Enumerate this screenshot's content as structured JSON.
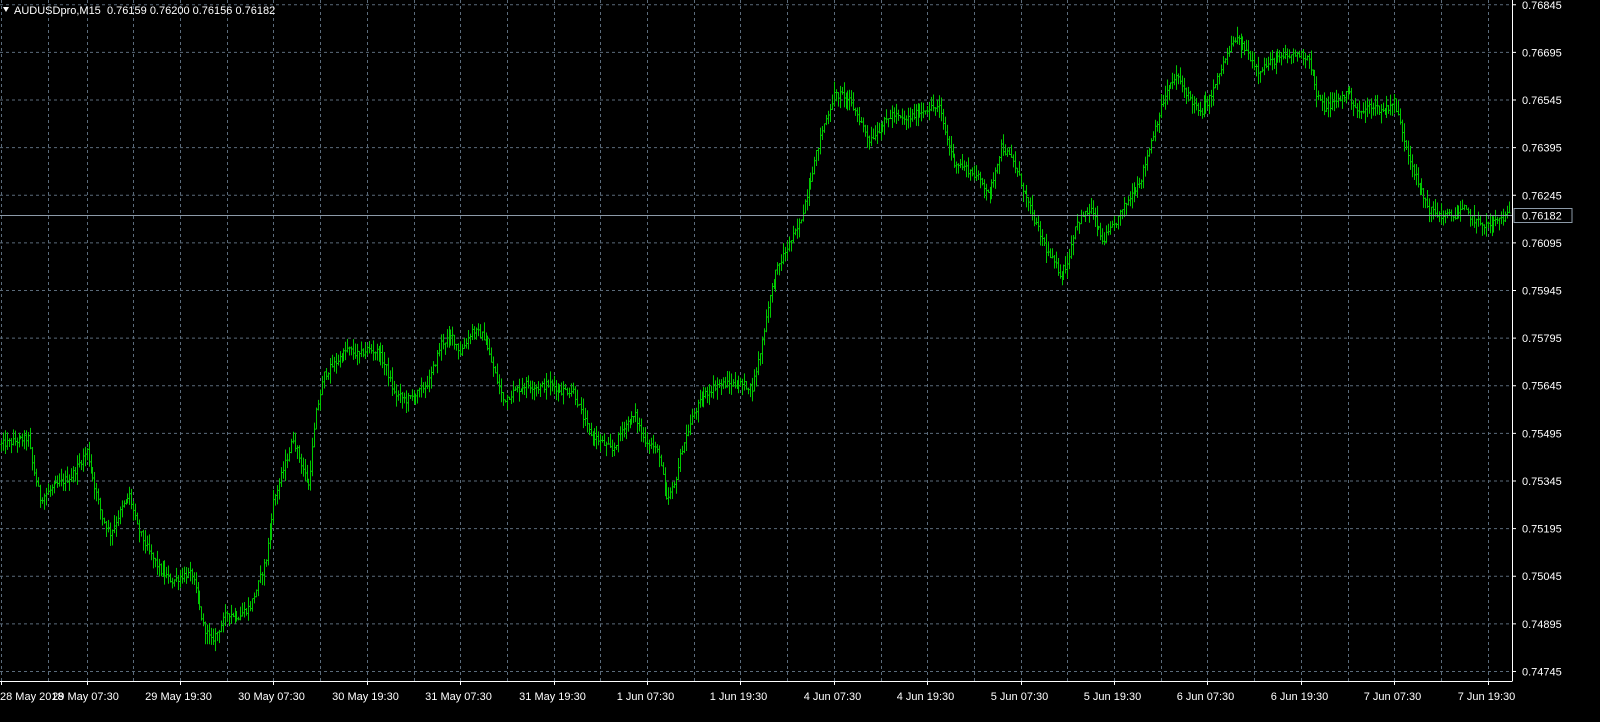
{
  "window": {
    "symbol_line": "AUDUSDpro,M15",
    "ohlc": "0.76159 0.76200 0.76156 0.76182",
    "menu_icon": "triangle-down-icon"
  },
  "colors": {
    "background": "#000000",
    "bars": "#00C800",
    "grid": "#5B6B7B",
    "axis_text": "#FFFFFF",
    "price_line": "#8C9AA8",
    "price_label_bg": "#000000"
  },
  "chart_data": {
    "type": "ohlc-bars",
    "symbol": "AUDUSDpro",
    "timeframe": "M15",
    "current_price": 0.76182,
    "current_price_label": "0.76182",
    "ylim": [
      0.74715,
      0.7686
    ],
    "y_ticks": [
      0.76845,
      0.76695,
      0.76545,
      0.76395,
      0.76245,
      0.76095,
      0.75945,
      0.75795,
      0.75645,
      0.75495,
      0.75345,
      0.75195,
      0.75045,
      0.74895,
      0.74745
    ],
    "y_tick_labels": [
      "0.76845",
      "0.76695",
      "0.76545",
      "0.76395",
      "0.76245",
      "0.76095",
      "0.75945",
      "0.75795",
      "0.75645",
      "0.75495",
      "0.75345",
      "0.75195",
      "0.75045",
      "0.74895",
      "0.74745"
    ],
    "x_tick_labels": [
      "28 May 2018",
      "29 May 07:30",
      "29 May 19:30",
      "30 May 07:30",
      "30 May 19:30",
      "31 May 07:30",
      "31 May 19:30",
      "1 Jun 07:30",
      "1 Jun 19:30",
      "4 Jun 07:30",
      "4 Jun 19:30",
      "5 Jun 07:30",
      "5 Jun 19:30",
      "6 Jun 07:30",
      "6 Jun 19:30",
      "7 Jun 07:30",
      "7 Jun 19:30"
    ],
    "x_tick_index": [
      0,
      44,
      92,
      140,
      188,
      236,
      284,
      332,
      380,
      428,
      476,
      524,
      572,
      620,
      668,
      716,
      764
    ],
    "bar_count": 776,
    "close_path": [
      [
        0,
        0.7546
      ],
      [
        14,
        0.7548
      ],
      [
        16,
        0.754
      ],
      [
        20,
        0.7529
      ],
      [
        28,
        0.7533
      ],
      [
        36,
        0.7536
      ],
      [
        44,
        0.7544
      ],
      [
        48,
        0.7533
      ],
      [
        52,
        0.7523
      ],
      [
        56,
        0.7518
      ],
      [
        62,
        0.7526
      ],
      [
        66,
        0.753
      ],
      [
        70,
        0.752
      ],
      [
        76,
        0.7512
      ],
      [
        82,
        0.7506
      ],
      [
        88,
        0.7503
      ],
      [
        94,
        0.7505
      ],
      [
        98,
        0.7505
      ],
      [
        104,
        0.7489
      ],
      [
        108,
        0.7484
      ],
      [
        112,
        0.7488
      ],
      [
        116,
        0.7493
      ],
      [
        122,
        0.7492
      ],
      [
        128,
        0.7495
      ],
      [
        132,
        0.7502
      ],
      [
        136,
        0.751
      ],
      [
        140,
        0.7528
      ],
      [
        146,
        0.754
      ],
      [
        150,
        0.7548
      ],
      [
        154,
        0.754
      ],
      [
        158,
        0.7533
      ],
      [
        162,
        0.7556
      ],
      [
        166,
        0.7568
      ],
      [
        172,
        0.7572
      ],
      [
        178,
        0.7576
      ],
      [
        184,
        0.7574
      ],
      [
        188,
        0.7576
      ],
      [
        194,
        0.7575
      ],
      [
        198,
        0.757
      ],
      [
        202,
        0.7562
      ],
      [
        208,
        0.756
      ],
      [
        214,
        0.7562
      ],
      [
        220,
        0.7566
      ],
      [
        226,
        0.7578
      ],
      [
        232,
        0.758
      ],
      [
        236,
        0.7575
      ],
      [
        242,
        0.7582
      ],
      [
        248,
        0.758
      ],
      [
        252,
        0.7572
      ],
      [
        258,
        0.756
      ],
      [
        264,
        0.7563
      ],
      [
        270,
        0.7565
      ],
      [
        276,
        0.7564
      ],
      [
        282,
        0.7565
      ],
      [
        288,
        0.7563
      ],
      [
        294,
        0.7563
      ],
      [
        298,
        0.7556
      ],
      [
        302,
        0.755
      ],
      [
        308,
        0.7547
      ],
      [
        314,
        0.7544
      ],
      [
        320,
        0.7552
      ],
      [
        326,
        0.7555
      ],
      [
        330,
        0.7548
      ],
      [
        334,
        0.7546
      ],
      [
        338,
        0.7543
      ],
      [
        342,
        0.7528
      ],
      [
        346,
        0.7533
      ],
      [
        350,
        0.7545
      ],
      [
        356,
        0.7556
      ],
      [
        362,
        0.7562
      ],
      [
        368,
        0.7565
      ],
      [
        374,
        0.7565
      ],
      [
        380,
        0.7565
      ],
      [
        386,
        0.7564
      ],
      [
        390,
        0.7575
      ],
      [
        394,
        0.759
      ],
      [
        398,
        0.76
      ],
      [
        404,
        0.7608
      ],
      [
        410,
        0.7615
      ],
      [
        416,
        0.763
      ],
      [
        422,
        0.7645
      ],
      [
        428,
        0.7656
      ],
      [
        434,
        0.7656
      ],
      [
        440,
        0.765
      ],
      [
        446,
        0.7642
      ],
      [
        452,
        0.7646
      ],
      [
        458,
        0.765
      ],
      [
        464,
        0.7648
      ],
      [
        470,
        0.765
      ],
      [
        476,
        0.7652
      ],
      [
        482,
        0.7652
      ],
      [
        486,
        0.7642
      ],
      [
        490,
        0.7635
      ],
      [
        496,
        0.7633
      ],
      [
        502,
        0.763
      ],
      [
        508,
        0.7625
      ],
      [
        514,
        0.764
      ],
      [
        520,
        0.7635
      ],
      [
        526,
        0.7625
      ],
      [
        532,
        0.7615
      ],
      [
        538,
        0.7606
      ],
      [
        544,
        0.76
      ],
      [
        548,
        0.7603
      ],
      [
        552,
        0.7615
      ],
      [
        556,
        0.7618
      ],
      [
        560,
        0.762
      ],
      [
        566,
        0.761
      ],
      [
        572,
        0.7615
      ],
      [
        578,
        0.7622
      ],
      [
        586,
        0.763
      ],
      [
        592,
        0.7644
      ],
      [
        598,
        0.7656
      ],
      [
        604,
        0.7662
      ],
      [
        610,
        0.7656
      ],
      [
        616,
        0.765
      ],
      [
        622,
        0.7656
      ],
      [
        628,
        0.7666
      ],
      [
        634,
        0.7674
      ],
      [
        640,
        0.767
      ],
      [
        646,
        0.7664
      ],
      [
        654,
        0.7667
      ],
      [
        660,
        0.7668
      ],
      [
        666,
        0.7669
      ],
      [
        672,
        0.7668
      ],
      [
        676,
        0.7656
      ],
      [
        680,
        0.7652
      ],
      [
        686,
        0.7654
      ],
      [
        692,
        0.7657
      ],
      [
        698,
        0.765
      ],
      [
        704,
        0.7653
      ],
      [
        710,
        0.7651
      ],
      [
        716,
        0.7654
      ],
      [
        722,
        0.764
      ],
      [
        728,
        0.7628
      ],
      [
        734,
        0.762
      ],
      [
        740,
        0.7618
      ],
      [
        746,
        0.7618
      ],
      [
        752,
        0.762
      ],
      [
        758,
        0.7616
      ],
      [
        764,
        0.7615
      ],
      [
        770,
        0.7617
      ],
      [
        775,
        0.76182
      ]
    ]
  }
}
